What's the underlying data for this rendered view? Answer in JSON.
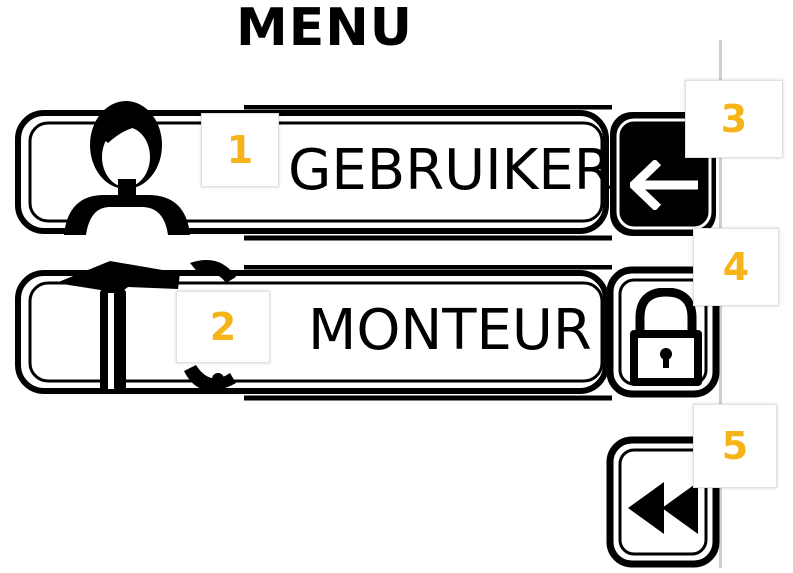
{
  "title": "MENU",
  "menu": {
    "items": [
      {
        "label": "GEBRUIKER",
        "badge": "1",
        "icon": "user-icon"
      },
      {
        "label": "MONTEUR",
        "badge": "2",
        "icon": "tools-icon"
      }
    ]
  },
  "side_buttons": [
    {
      "name": "back",
      "badge": "3",
      "icon": "arrow-left-icon"
    },
    {
      "name": "lock",
      "badge": "4",
      "icon": "lock-icon"
    },
    {
      "name": "rewind",
      "badge": "5",
      "icon": "double-chevron-left-icon"
    }
  ],
  "colors": {
    "badge_text": "#f6b418",
    "frame": "#000000",
    "background": "#ffffff"
  }
}
